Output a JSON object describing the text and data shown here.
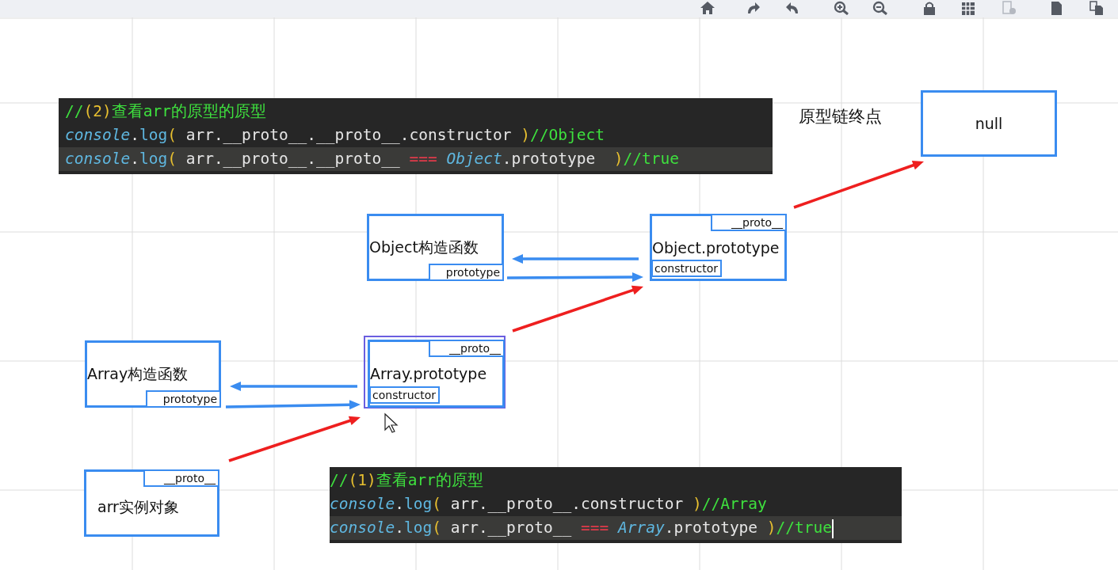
{
  "toolbar": {
    "buttons": [
      {
        "disabled": false
      },
      {
        "disabled": false
      },
      {
        "disabled": false
      },
      {
        "disabled": false
      },
      {
        "disabled": false
      },
      {
        "disabled": false
      },
      {
        "disabled": false
      },
      {
        "disabled": true
      },
      {
        "disabled": false
      },
      {
        "disabled": false
      }
    ]
  },
  "code_blocks": [
    {
      "lines": [
        {
          "highlighted": false,
          "cursor": false,
          "segments": [
            {
              "kind": "comment",
              "text": "//"
            },
            {
              "kind": "paren",
              "text": "(2)"
            },
            {
              "kind": "comment",
              "text": "查看arr的原型的原型"
            }
          ]
        },
        {
          "highlighted": false,
          "cursor": false,
          "segments": [
            {
              "kind": "object",
              "text": "console"
            },
            {
              "kind": "plain",
              "text": "."
            },
            {
              "kind": "method",
              "text": "log"
            },
            {
              "kind": "paren",
              "text": "("
            },
            {
              "kind": "plain",
              "text": " arr.__proto__.__proto__.constructor "
            },
            {
              "kind": "paren",
              "text": ")"
            },
            {
              "kind": "comment",
              "text": "//Object"
            }
          ]
        },
        {
          "highlighted": true,
          "cursor": false,
          "segments": [
            {
              "kind": "object",
              "text": "console"
            },
            {
              "kind": "plain",
              "text": "."
            },
            {
              "kind": "method",
              "text": "log"
            },
            {
              "kind": "paren",
              "text": "("
            },
            {
              "kind": "plain",
              "text": " arr.__proto__.__proto__ "
            },
            {
              "kind": "operator",
              "text": "=== "
            },
            {
              "kind": "object",
              "text": "Object"
            },
            {
              "kind": "plain",
              "text": ".prototype  "
            },
            {
              "kind": "paren",
              "text": ")"
            },
            {
              "kind": "comment",
              "text": "//true"
            }
          ]
        }
      ]
    },
    {
      "lines": [
        {
          "highlighted": false,
          "cursor": false,
          "segments": [
            {
              "kind": "comment",
              "text": "//"
            },
            {
              "kind": "paren",
              "text": "(1)"
            },
            {
              "kind": "comment",
              "text": "查看arr的原型"
            }
          ]
        },
        {
          "highlighted": false,
          "cursor": false,
          "segments": [
            {
              "kind": "object",
              "text": "console"
            },
            {
              "kind": "plain",
              "text": "."
            },
            {
              "kind": "method",
              "text": "log"
            },
            {
              "kind": "paren",
              "text": "("
            },
            {
              "kind": "plain",
              "text": " arr.__proto__.constructor "
            },
            {
              "kind": "paren",
              "text": ")"
            },
            {
              "kind": "comment",
              "text": "//Array"
            }
          ]
        },
        {
          "highlighted": true,
          "cursor": true,
          "segments": [
            {
              "kind": "object",
              "text": "console"
            },
            {
              "kind": "plain",
              "text": "."
            },
            {
              "kind": "method",
              "text": "log"
            },
            {
              "kind": "paren",
              "text": "("
            },
            {
              "kind": "plain",
              "text": " arr.__proto__ "
            },
            {
              "kind": "operator",
              "text": "=== "
            },
            {
              "kind": "object",
              "text": "Array"
            },
            {
              "kind": "plain",
              "text": ".prototype "
            },
            {
              "kind": "paren",
              "text": ")"
            },
            {
              "kind": "comment",
              "text": "//true"
            }
          ]
        }
      ]
    }
  ],
  "end_label": "原型链终点",
  "nodes": [
    {
      "label": "null",
      "selected": false
    },
    {
      "label": "Object构造函数",
      "selected": false,
      "tags": [
        {
          "kind": "prototype",
          "text": "prototype"
        }
      ]
    },
    {
      "label": "Object.prototype",
      "selected": false,
      "tags": [
        {
          "kind": "proto",
          "text": "__proto__"
        },
        {
          "kind": "constructor",
          "text": "constructor"
        }
      ]
    },
    {
      "label": "Array构造函数",
      "selected": false,
      "tags": [
        {
          "kind": "prototype",
          "text": "prototype"
        }
      ]
    },
    {
      "label": "Array.prototype",
      "selected": true,
      "tags": [
        {
          "kind": "proto",
          "text": "__proto__"
        },
        {
          "kind": "constructor",
          "text": "constructor"
        }
      ]
    },
    {
      "label": "arr实例对象",
      "selected": false,
      "tags": [
        {
          "kind": "proto",
          "text": "__proto__"
        }
      ]
    }
  ],
  "arrows": [
    {
      "color": "#3a8cf0"
    },
    {
      "color": "#3a8cf0"
    },
    {
      "color": "#ee1f1f"
    },
    {
      "color": "#ee1f1f"
    },
    {
      "color": "#3a8cf0"
    },
    {
      "color": "#3a8cf0"
    },
    {
      "color": "#ee1f1f"
    }
  ]
}
